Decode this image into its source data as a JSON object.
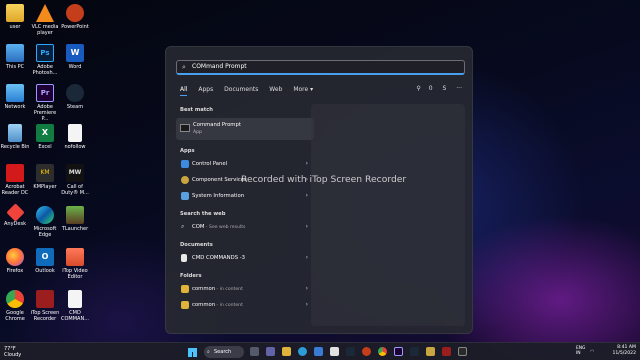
{
  "desktop": {
    "icons": [
      {
        "label": "user",
        "icon": "folder-icon"
      },
      {
        "label": "VLC media player",
        "icon": "vlc-icon"
      },
      {
        "label": "PowerPoint",
        "icon": "powerpoint-icon"
      },
      {
        "label": "This PC",
        "icon": "computer-icon"
      },
      {
        "label": "Adobe Photosh...",
        "icon": "photoshop-icon"
      },
      {
        "label": "Word",
        "icon": "word-icon"
      },
      {
        "label": "Network",
        "icon": "network-icon"
      },
      {
        "label": "Adobe Premiere P...",
        "icon": "premiere-icon"
      },
      {
        "label": "Steam",
        "icon": "steam-icon"
      },
      {
        "label": "Recycle Bin",
        "icon": "recycle-bin-icon"
      },
      {
        "label": "Excel",
        "icon": "excel-icon"
      },
      {
        "label": "nofollow",
        "icon": "file-icon"
      },
      {
        "label": "Acrobat Reader DC",
        "icon": "acrobat-icon"
      },
      {
        "label": "KMPlayer",
        "icon": "kmplayer-icon"
      },
      {
        "label": "Call of Duty® M...",
        "icon": "cod-icon"
      },
      {
        "label": "AnyDesk",
        "icon": "anydesk-icon"
      },
      {
        "label": "Microsoft Edge",
        "icon": "edge-icon"
      },
      {
        "label": "TLauncher",
        "icon": "tlauncher-icon"
      },
      {
        "label": "Firefox",
        "icon": "firefox-icon"
      },
      {
        "label": "Outlook",
        "icon": "outlook-icon"
      },
      {
        "label": "iTop Video Editor",
        "icon": "itop-editor-icon"
      },
      {
        "label": "Google Chrome",
        "icon": "chrome-icon"
      },
      {
        "label": "iTop Screen Recorder",
        "icon": "screen-recorder-icon"
      },
      {
        "label": "CMD COMMAN...",
        "icon": "file-icon"
      }
    ]
  },
  "search": {
    "query": "COMmand Prompt",
    "filters": [
      "All",
      "Apps",
      "Documents",
      "Web",
      "More ▾"
    ],
    "right_badge": "0",
    "right_letter": "S",
    "more_dots": "···"
  },
  "results": {
    "best_match_header": "Best match",
    "best_match": {
      "title": "Command Prompt",
      "subtitle": "App"
    },
    "apps_header": "Apps",
    "apps": [
      "Control Panel",
      "Component Services",
      "System Information"
    ],
    "web_header": "Search the web",
    "web": {
      "term": "COM",
      "suffix": " - See web results"
    },
    "documents_header": "Documents",
    "documents": [
      "CMD COMMANDS -3"
    ],
    "folders_header": "Folders",
    "folders": [
      {
        "name": "common",
        "suffix": " - in content"
      },
      {
        "name": "common",
        "suffix": " - in content"
      }
    ]
  },
  "watermark": "Recorded with iTop Screen Recorder",
  "taskbar": {
    "weather_temp": "77°F",
    "weather_desc": "Cloudy",
    "search_label": "Search",
    "lang": "ENG",
    "region": "IN",
    "time": "8:41 AM",
    "date": "11/5/2022"
  },
  "colors": {
    "accent": "#4aa0f0",
    "panel": "#26282f"
  }
}
